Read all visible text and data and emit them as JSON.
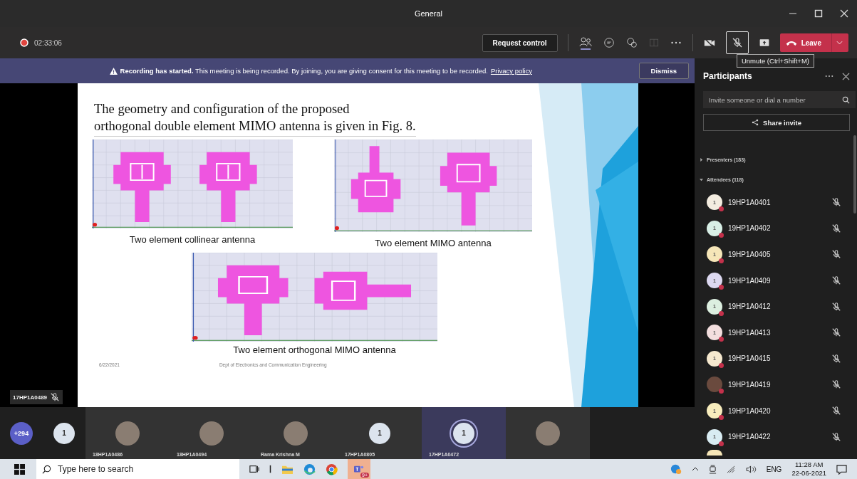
{
  "window": {
    "title": "General"
  },
  "meeting": {
    "timer": "02:33:06",
    "request_control": "Request control",
    "leave": "Leave",
    "mic_muted": true,
    "tooltip": "Unmute (Ctrl+Shift+M)"
  },
  "banner": {
    "bold": "Recording has started.",
    "text": "This meeting is being recorded. By joining, you are giving consent for this meeting to be recorded.",
    "link": "Privacy policy",
    "dismiss": "Dismiss"
  },
  "slide": {
    "title_lines": [
      "The geometry and configuration of the proposed",
      "orthogonal double element MIMO antenna is given in  Fig. 8."
    ],
    "figures": [
      {
        "caption": "Two element collinear antenna",
        "kind": "collinear"
      },
      {
        "caption": "Two element MIMO antenna",
        "kind": "mimo"
      },
      {
        "caption": "Two element orthogonal MIMO antenna",
        "kind": "orthogonal"
      }
    ],
    "date": "6/22/2021",
    "department": "Dept of Electronics and Communication Engineering"
  },
  "speaker": {
    "name": "17HP1A0489"
  },
  "participants": {
    "title": "Participants",
    "search_placeholder": "Invite someone or dial a number",
    "share": "Share invite",
    "sections": [
      {
        "label": "Presenters (183)",
        "expanded": false
      },
      {
        "label": "Attendees (118)",
        "expanded": true
      }
    ],
    "attendees": [
      {
        "name": "19HP1A0401",
        "initial": "1",
        "color": "#f3ece0",
        "kind": "initial"
      },
      {
        "name": "19HP1A0402",
        "initial": "1",
        "color": "#d8efe6",
        "kind": "initial"
      },
      {
        "name": "19HP1A0405",
        "initial": "1",
        "color": "#f6e6b8",
        "kind": "initial"
      },
      {
        "name": "19HP1A0409",
        "initial": "1",
        "color": "#dcd8f0",
        "kind": "initial"
      },
      {
        "name": "19HP1A0412",
        "initial": "1",
        "color": "#dcefe0",
        "kind": "initial"
      },
      {
        "name": "19HP1A0413",
        "initial": "1",
        "color": "#f3dede",
        "kind": "initial"
      },
      {
        "name": "19HP1A0415",
        "initial": "1",
        "color": "#f6e9cf",
        "kind": "initial"
      },
      {
        "name": "19HP1A0419",
        "kind": "photo"
      },
      {
        "name": "19HP1A0420",
        "initial": "1",
        "color": "#f8edbd",
        "kind": "initial"
      },
      {
        "name": "19HP1A0422",
        "initial": "1",
        "color": "#d8ecf2",
        "kind": "initial"
      }
    ]
  },
  "gallery": [
    {
      "kind": "count",
      "label": "+294",
      "selected": false
    },
    {
      "kind": "initial",
      "initial": "1",
      "selected": false
    },
    {
      "kind": "photo",
      "name": "18HP1A0486",
      "selected": false
    },
    {
      "kind": "photo",
      "name": "18HP1A0494",
      "selected": false
    },
    {
      "kind": "photo",
      "name": "Rama Krishna M",
      "selected": false
    },
    {
      "kind": "initial",
      "initial": "1",
      "name": "17HP1A0805",
      "selected": false
    },
    {
      "kind": "initial",
      "initial": "1",
      "name": "17HP1A0472",
      "selected": true
    },
    {
      "kind": "photo",
      "selected": false
    }
  ],
  "taskbar": {
    "search_placeholder": "Type here to search",
    "teams_badge": "9+",
    "language": "ENG",
    "time": "11:28 AM",
    "date": "22-06-2021"
  }
}
